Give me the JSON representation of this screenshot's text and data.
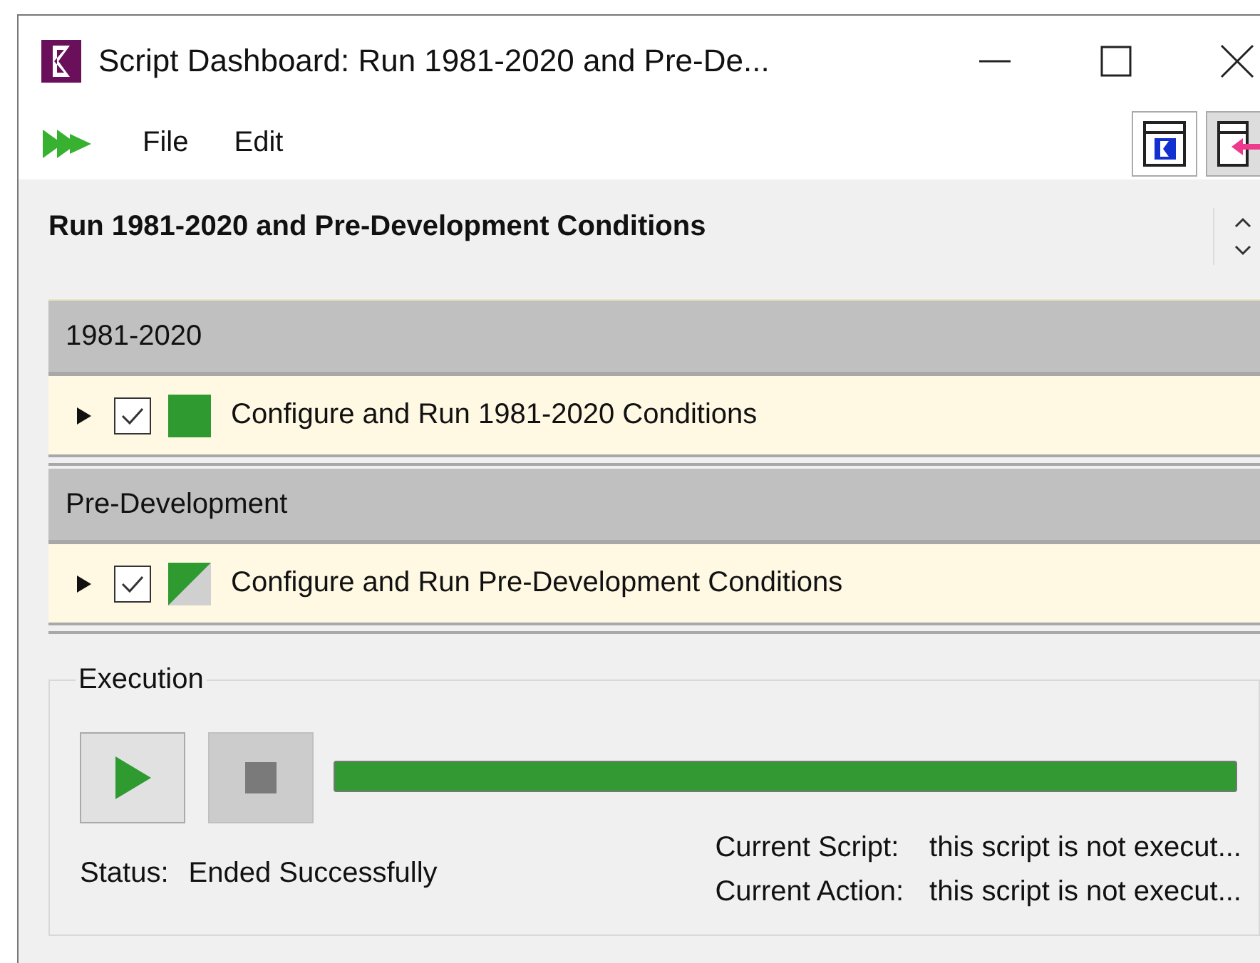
{
  "window": {
    "title": "Script Dashboard: Run 1981-2020 and Pre-De..."
  },
  "menu": [
    "File",
    "Edit"
  ],
  "dashboard": {
    "heading": "Run 1981-2020 and Pre-Development Conditions",
    "groups": [
      {
        "name": "1981-2020",
        "scripts": [
          {
            "name": "Configure and Run 1981-2020 Conditions",
            "expanded": false,
            "checked": true,
            "kind": "complete"
          }
        ]
      },
      {
        "name": "Pre-Development",
        "scripts": [
          {
            "name": "Configure and Run Pre-Development Conditions",
            "expanded": false,
            "checked": true,
            "kind": "partial"
          }
        ]
      }
    ]
  },
  "execution": {
    "title": "Execution",
    "stop_disabled": true,
    "level": 1,
    "status_label": "Status:",
    "status": "Ended Successfully",
    "info": [
      {
        "label": "Current Script:",
        "value": "this script is not execut..."
      },
      {
        "label": "Current Action:",
        "value": "this script is not execut..."
      }
    ]
  }
}
